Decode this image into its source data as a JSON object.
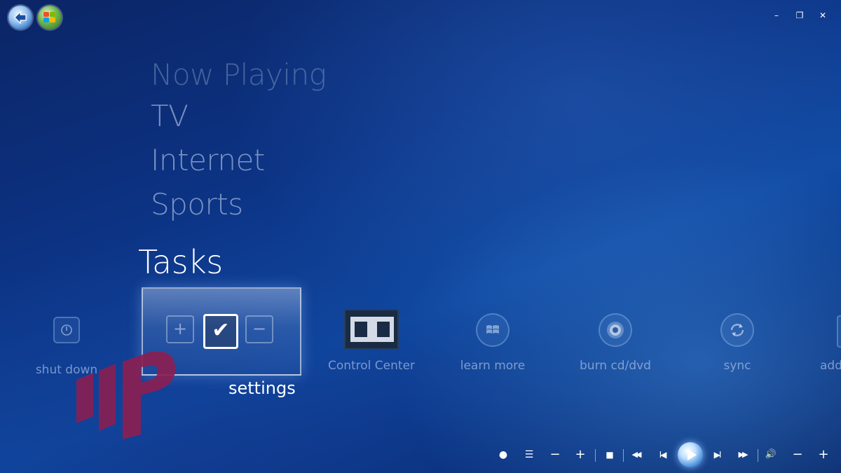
{
  "window": {
    "back_icon": "back-arrow-icon",
    "start_icon": "windows-logo-icon",
    "controls": {
      "minimize": "–",
      "restore": "❐",
      "close": "✕"
    }
  },
  "menu": {
    "items": [
      "Now Playing",
      "TV",
      "Internet",
      "Sports"
    ],
    "current": "Tasks"
  },
  "tasks_strip": {
    "items": [
      {
        "label": "shut down",
        "icon": "power-icon"
      },
      {
        "label": "settings",
        "icon": "checkmark-icon",
        "focused": true
      },
      {
        "label": "Control Center",
        "icon": "dolby-icon"
      },
      {
        "label": "learn more",
        "icon": "windows-logo-icon"
      },
      {
        "label": "burn cd/dvd",
        "icon": "disc-icon"
      },
      {
        "label": "sync",
        "icon": "sync-icon"
      },
      {
        "label": "add",
        "icon": "add-icon"
      }
    ],
    "settings_tile": {
      "plus": "+",
      "check": "✔",
      "minus": "−"
    }
  },
  "transport": {
    "record": "●",
    "list": "☰",
    "ch_down": "−",
    "ch_up": "+",
    "stop": "■",
    "rewind": "◀◀",
    "prev": "I◀",
    "play": "▶",
    "next": "▶I",
    "fast_forward": "▶▶",
    "volume": "🔊",
    "vol_down": "−",
    "vol_up": "+"
  },
  "colors": {
    "background": "#0c3384",
    "accent": "#3b86d6",
    "watermark": "#8a1f52"
  }
}
